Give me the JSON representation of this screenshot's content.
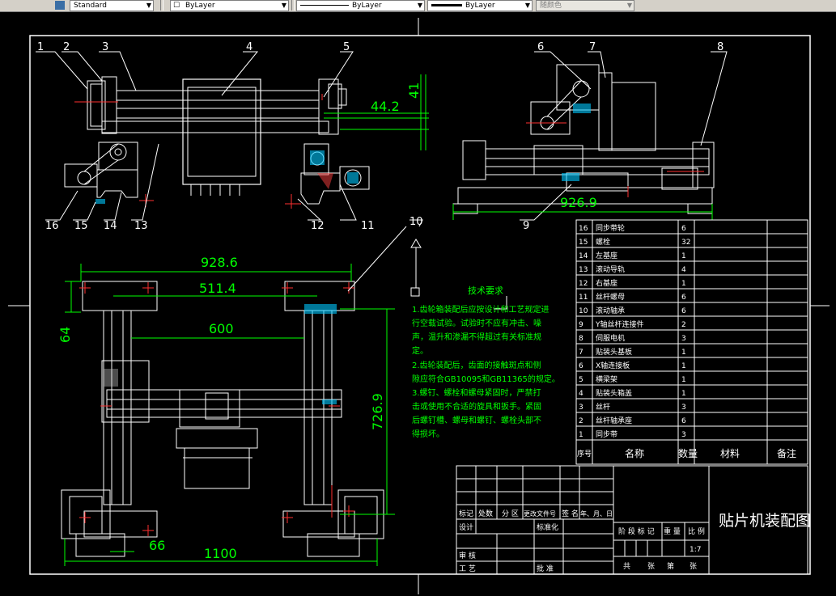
{
  "toolbar": {
    "text_style": "Standard",
    "layer": "ByLayer",
    "linetype": "ByLayer",
    "lineweight": "ByLayer",
    "color": "随颜色"
  },
  "balloons": [
    "1",
    "2",
    "3",
    "4",
    "5",
    "6",
    "7",
    "8",
    "9",
    "10",
    "11",
    "12",
    "13",
    "14",
    "15",
    "16"
  ],
  "dimensions": {
    "d_44_2": "44.2",
    "d_41": "41",
    "d_926_9": "926.9",
    "d_928_6": "928.6",
    "d_511_4": "511.4",
    "d_600": "600",
    "d_64": "64",
    "d_726_9": "726.9",
    "d_66": "66",
    "d_1100": "1100"
  },
  "tech_notes": {
    "title": "技术要求",
    "lines": [
      "1.齿轮箱装配后应按设计和工艺规定进",
      "行空载试验。试验时不应有冲击、噪",
      "声，温升和渗漏不得超过有关标准规",
      "定。",
      "2.齿轮装配后，齿面的接触斑点和侧",
      "隙应符合GB10095和GB11365的规定。",
      "3.螺钉、螺栓和螺母紧固时，严禁打",
      "击或使用不合适的旋具和扳手。紧固",
      "后螺钉槽、螺母和螺钉、螺栓头部不",
      "得损坏。"
    ]
  },
  "bom": {
    "rows": [
      {
        "no": "16",
        "name": "同步带轮",
        "qty": "6"
      },
      {
        "no": "15",
        "name": "螺栓",
        "qty": "32"
      },
      {
        "no": "14",
        "name": "左基座",
        "qty": "1"
      },
      {
        "no": "13",
        "name": "滚动导轨",
        "qty": "4"
      },
      {
        "no": "12",
        "name": "右基座",
        "qty": "1"
      },
      {
        "no": "11",
        "name": "丝杆螺母",
        "qty": "6"
      },
      {
        "no": "10",
        "name": "滚动轴承",
        "qty": "6"
      },
      {
        "no": "9",
        "name": "Y轴丝杆连接件",
        "qty": "2"
      },
      {
        "no": "8",
        "name": "伺服电机",
        "qty": "3"
      },
      {
        "no": "7",
        "name": "贴装头基板",
        "qty": "1"
      },
      {
        "no": "6",
        "name": "X轴连接板",
        "qty": "1"
      },
      {
        "no": "5",
        "name": "横梁架",
        "qty": "1"
      },
      {
        "no": "4",
        "name": "贴装头箱盖",
        "qty": "1"
      },
      {
        "no": "3",
        "name": "丝杆",
        "qty": "3"
      },
      {
        "no": "2",
        "name": "丝杆轴承座",
        "qty": "6"
      },
      {
        "no": "1",
        "name": "同步带",
        "qty": "3"
      }
    ],
    "headers": {
      "no": "序号",
      "name": "名称",
      "qty": "数量",
      "material": "材料",
      "remark": "备注"
    }
  },
  "title_block": {
    "drawing_title": "贴片机装配图",
    "scale": "1:7",
    "labels": {
      "biaoji": "标记",
      "chushu": "处数",
      "fenqu": "分 区",
      "genggai": "更改文件号",
      "qianming": "签 名",
      "nianyueri": "年、月、日",
      "sheji": "设计",
      "biaozhunhua": "标准化",
      "jieduan": "阶 段 标 记",
      "zhongliang": "重 量",
      "bili": "比 例",
      "shenhe": "审 核",
      "gongyi": "工 艺",
      "pizhun": "批 准",
      "gong": "共",
      "zhang": "张",
      "di": "第",
      "zhang2": "张"
    }
  }
}
